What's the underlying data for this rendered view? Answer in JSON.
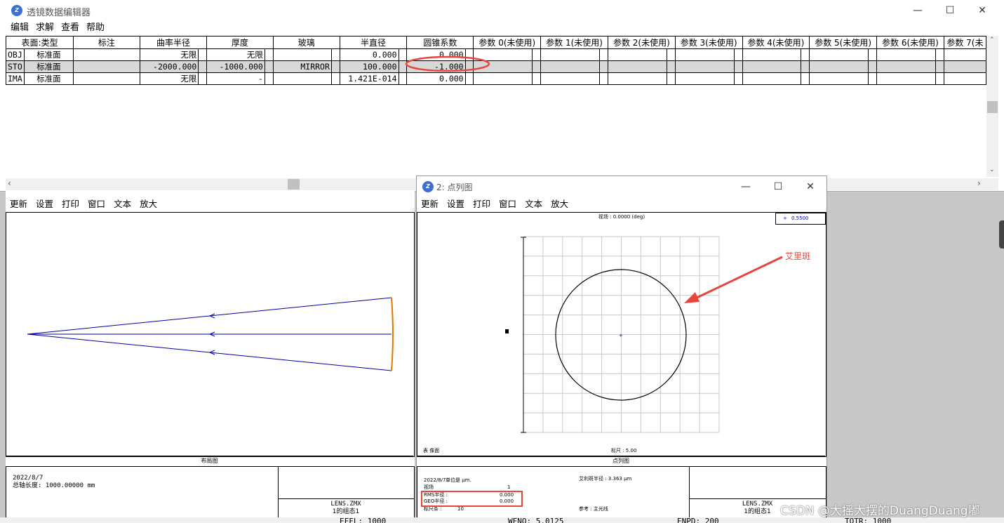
{
  "editor": {
    "title": "透镜数据编辑器",
    "menu": [
      "编辑",
      "求解",
      "查看",
      "帮助"
    ],
    "columns": [
      "表面:类型",
      "标注",
      "曲率半径",
      "厚度",
      "玻璃",
      "半直径",
      "圆锥系数",
      "参数 0(未使用)",
      "参数 1(未使用)",
      "参数 2(未使用)",
      "参数 3(未使用)",
      "参数 4(未使用)",
      "参数 5(未使用)",
      "参数 6(未使用)",
      "参数 7(未"
    ],
    "rows": [
      {
        "surf": "OBJ",
        "type": "标准面",
        "comment": "",
        "radius": "无限",
        "thickness": "无限",
        "glass": "",
        "semi_diameter": "0.000",
        "conic": "0.000"
      },
      {
        "surf": "STO",
        "type": "标准面",
        "comment": "",
        "radius": "-2000.000",
        "thickness": "-1000.000",
        "glass": "MIRROR",
        "semi_diameter": "100.000",
        "conic": "-1.000"
      },
      {
        "surf": "IMA",
        "type": "标准面",
        "comment": "",
        "radius": "无限",
        "thickness": "-",
        "glass": "",
        "semi_diameter": "1.421E-014",
        "conic": "0.000"
      }
    ]
  },
  "layout_window": {
    "toolbar": [
      "更新",
      "设置",
      "打印",
      "窗口",
      "文本",
      "放大"
    ],
    "caption": "布局图",
    "date": "2022/8/7",
    "total_length": "总轴长度: 1000.00000 mm",
    "file": "LENS.ZMX",
    "config": "1的组态1"
  },
  "spot_window": {
    "title": "2: 点列图",
    "toolbar": [
      "更新",
      "设置",
      "打印",
      "窗口",
      "文本",
      "放大"
    ],
    "legend_value": "0.5500",
    "field_label": "视场 : 0.0000 (deg)",
    "surface_label": "表 像面",
    "scale_label": "标尺 : 5.00",
    "caption": "点列图",
    "date": "2022/8/7",
    "units": "单位是 µm.",
    "field_row_label": "视场",
    "field_row_value": "1",
    "rms_label": "RMS半径 :",
    "rms_value": "0.000",
    "geo_label": "GEO半径 :",
    "geo_value": "0.000",
    "scale_row": "标尺条 :",
    "scale_row_value": "10",
    "airy": "艾利斑半径 : 3.363 µm",
    "reference": "参考 : 主光线",
    "file": "LENS.ZMX",
    "config": "1的组态1"
  },
  "annotation": {
    "label": "艾里斑",
    "color": "#e8453c"
  },
  "status_bar": [
    "EFFL: 1000",
    "WFNO: 5.0125",
    "ENPD: 200",
    "TOTR: 1000"
  ],
  "watermark": "CSDN @大摇大摆的DuangDuang嘟",
  "colors": {
    "ray": "#0000aa",
    "mirror": "#e07800",
    "highlight": "#e8453c"
  }
}
